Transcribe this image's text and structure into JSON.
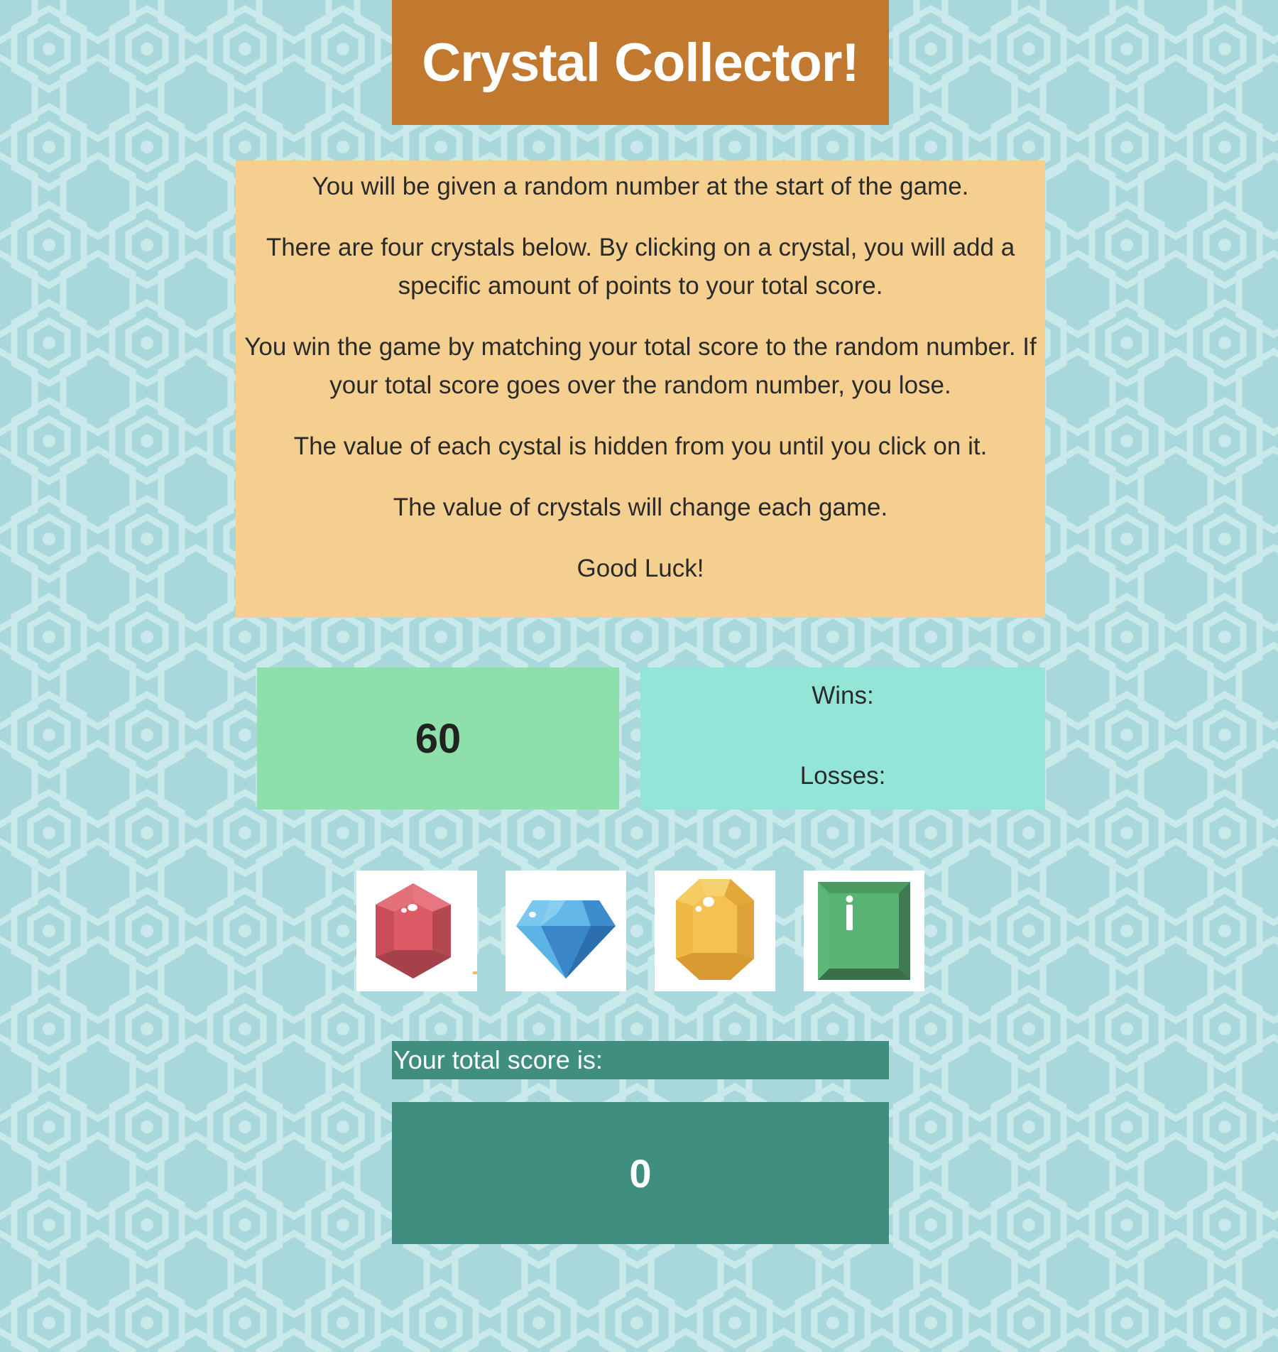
{
  "header": {
    "title": "Crystal Collector!"
  },
  "instructions": {
    "paragraphs": [
      "You will be given a random number at the start of the game.",
      "There are four crystals below. By clicking on a crystal, you will add a specific amount of points to your total score.",
      "You win the game by matching your total score to the random number. If your total score goes over the random number, you lose.",
      "The value of each cystal is hidden from you until you click on it.",
      "The value of crystals will change each game.",
      "Good Luck!"
    ]
  },
  "target": {
    "number": "60"
  },
  "record": {
    "wins_label": "Wins:",
    "losses_label": "Losses:"
  },
  "crystals": [
    {
      "icon": "red-gem-icon",
      "color": "#d95763"
    },
    {
      "icon": "blue-diamond-icon",
      "color": "#4aa8e0"
    },
    {
      "icon": "yellow-gem-icon",
      "color": "#f3c04f"
    },
    {
      "icon": "green-emerald-icon",
      "color": "#56b06f"
    }
  ],
  "score": {
    "label": "Your total score is:",
    "value": "0"
  },
  "colors": {
    "background": "#a9d8dc",
    "title_bg": "#c1782f",
    "instructions_bg": "#f5cf8f",
    "target_bg": "#8de0aa",
    "record_bg": "#93e6d7",
    "score_bg": "#3f8e7f"
  }
}
